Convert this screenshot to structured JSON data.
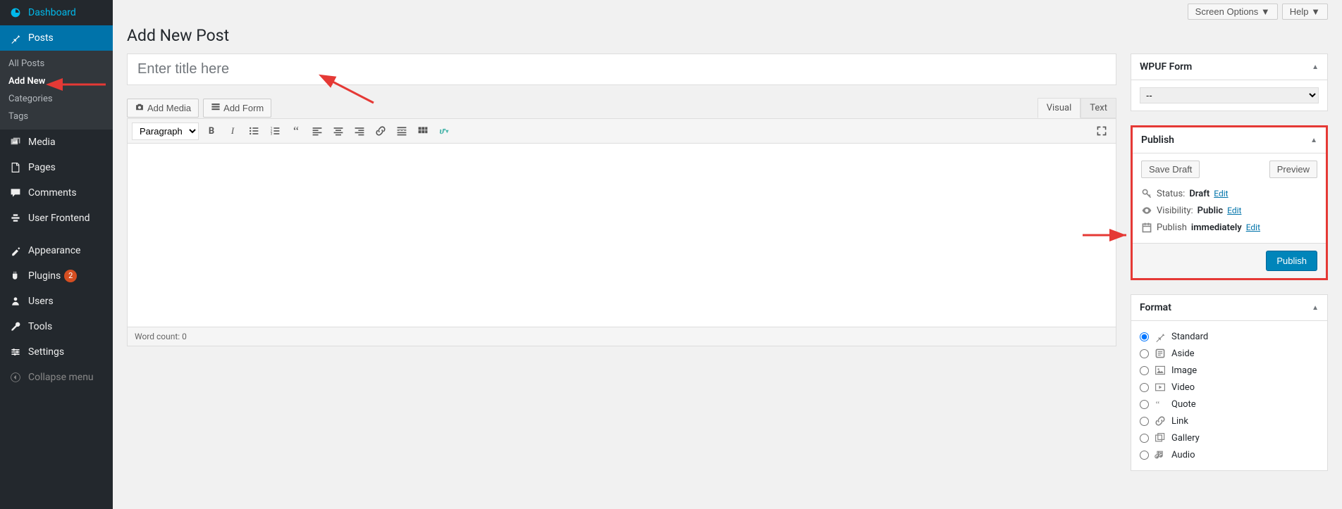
{
  "topbar": {
    "screen_options": "Screen Options",
    "help": "Help"
  },
  "sidebar": {
    "dashboard": "Dashboard",
    "posts": "Posts",
    "submenu": {
      "all_posts": "All Posts",
      "add_new": "Add New",
      "categories": "Categories",
      "tags": "Tags"
    },
    "media": "Media",
    "pages": "Pages",
    "comments": "Comments",
    "user_frontend": "User Frontend",
    "appearance": "Appearance",
    "plugins": "Plugins",
    "plugins_count": "2",
    "users": "Users",
    "tools": "Tools",
    "settings": "Settings",
    "collapse": "Collapse menu"
  },
  "page": {
    "title": "Add New Post"
  },
  "title_input": {
    "placeholder": "Enter title here"
  },
  "media_row": {
    "add_media": "Add Media",
    "add_form": "Add Form"
  },
  "tabs": {
    "visual": "Visual",
    "text": "Text"
  },
  "toolbar": {
    "paragraph": "Paragraph"
  },
  "status_bar": {
    "word_count": "Word count: 0"
  },
  "wpuf": {
    "title": "WPUF Form",
    "options": [
      "--"
    ],
    "selected": "--"
  },
  "publish": {
    "title": "Publish",
    "save_draft": "Save Draft",
    "preview": "Preview",
    "status_label": "Status:",
    "status_value": "Draft",
    "visibility_label": "Visibility:",
    "visibility_value": "Public",
    "schedule_label": "Publish",
    "schedule_value": "immediately",
    "edit": "Edit",
    "publish_btn": "Publish"
  },
  "format": {
    "title": "Format",
    "items": [
      {
        "name": "standard",
        "label": "Standard"
      },
      {
        "name": "aside",
        "label": "Aside"
      },
      {
        "name": "image",
        "label": "Image"
      },
      {
        "name": "video",
        "label": "Video"
      },
      {
        "name": "quote",
        "label": "Quote"
      },
      {
        "name": "link",
        "label": "Link"
      },
      {
        "name": "gallery",
        "label": "Gallery"
      },
      {
        "name": "audio",
        "label": "Audio"
      }
    ],
    "selected": "standard"
  }
}
